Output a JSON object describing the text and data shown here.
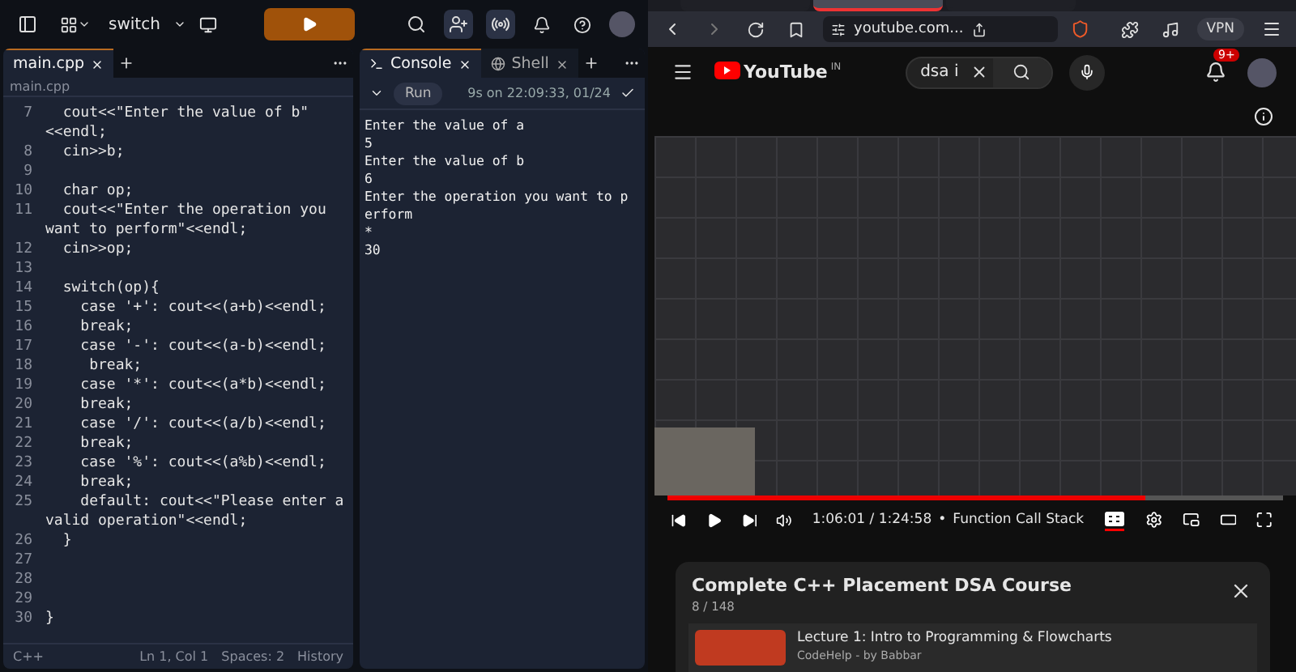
{
  "replit": {
    "project": "switch",
    "editor": {
      "tabs": [
        {
          "label": "main.cpp",
          "selected": true
        }
      ],
      "breadcrumb": "main.cpp",
      "lines": [
        {
          "number": "7",
          "text": "  cout<<\"Enter the value of b\"",
          "continuation": "<<endl;"
        },
        {
          "number": "8",
          "text": "  cin>>b;"
        },
        {
          "number": "9"
        },
        {
          "number": "10",
          "text": "  char op;"
        },
        {
          "number": "11",
          "text": "  cout<<\"Enter the operation you",
          "continuation": "want to perform\"<<endl;"
        },
        {
          "number": "12",
          "text": "  cin>>op;"
        },
        {
          "number": "13"
        },
        {
          "number": "14",
          "text": "  switch(op){"
        },
        {
          "number": "15",
          "text": "    case '+': cout<<(a+b)<<endl;"
        },
        {
          "number": "16",
          "text": "    break;"
        },
        {
          "number": "17",
          "text": "    case '-': cout<<(a-b)<<endl;"
        },
        {
          "number": "18",
          "text": "     break;"
        },
        {
          "number": "19",
          "text": "    case '*': cout<<(a*b)<<endl;"
        },
        {
          "number": "20",
          "text": "    break;"
        },
        {
          "number": "21",
          "text": "    case '/': cout<<(a/b)<<endl;"
        },
        {
          "number": "22",
          "text": "    break;"
        },
        {
          "number": "23",
          "text": "    case '%': cout<<(a%b)<<endl;"
        },
        {
          "number": "24",
          "text": "    break;"
        },
        {
          "number": "25",
          "text": "    default: cout<<\"Please enter a",
          "continuation": "valid operation\"<<endl;"
        },
        {
          "number": "26",
          "text": "  }"
        },
        {
          "number": "27"
        },
        {
          "number": "28"
        },
        {
          "number": "29"
        },
        {
          "number": "30",
          "text": "}"
        }
      ],
      "status": {
        "language": "C++",
        "position": "Ln 1, Col 1",
        "spaces": "Spaces: 2",
        "history": "History"
      }
    },
    "console": {
      "tabs": [
        {
          "label": "Console",
          "kind": "console",
          "selected": true
        },
        {
          "label": "Shell",
          "kind": "shell",
          "selected": false
        }
      ],
      "run": "Run",
      "timing": "9s on 22:09:33, 01/24",
      "output": [
        "Enter the value of a",
        "5",
        "Enter the value of b",
        "6",
        "Enter the operation you want to p",
        "erform",
        "*",
        "30"
      ]
    }
  },
  "browser": {
    "tabs": [
      {
        "selected": false
      },
      {
        "selected": true
      },
      {
        "selected": false
      }
    ],
    "url": "youtube.com...",
    "vpn": "VPN",
    "youtube": {
      "logo": "YouTube",
      "region": "IN",
      "search": "dsa i",
      "notifications": "9+",
      "player": {
        "level": 0.777,
        "time": "1:06:01 / 1:24:58",
        "separator": "•",
        "chapter": "Function Call Stack",
        "captions_on": true
      },
      "playlist": {
        "title": "Complete C++ Placement DSA Course",
        "count": "8 / 148",
        "items": [
          {
            "title": "Lecture 1: Intro to Programming & Flowcharts",
            "channel": "CodeHelp - by Babbar"
          }
        ]
      }
    }
  }
}
